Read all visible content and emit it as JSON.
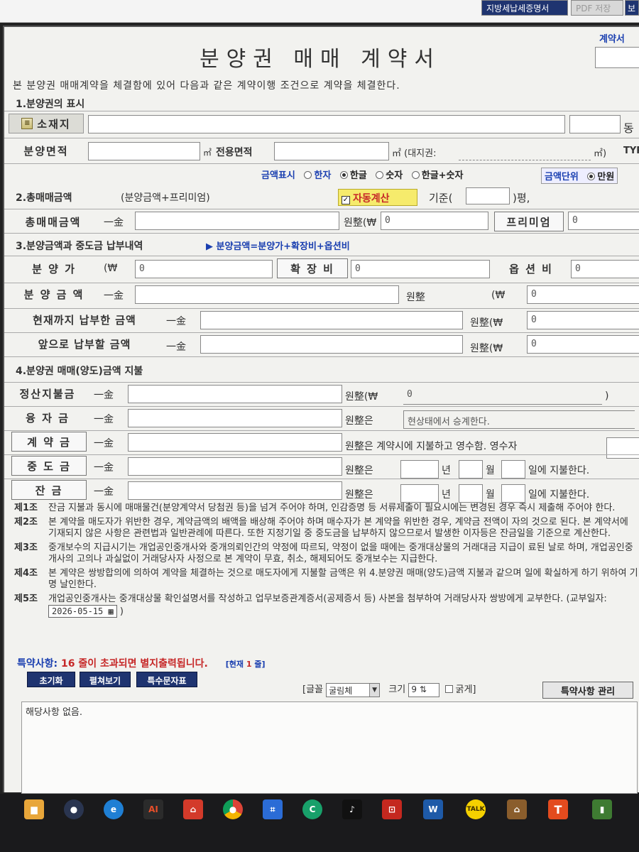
{
  "topbar": {
    "tax_button": "지방세납세증명서",
    "pdf_button": "PDF 저장",
    "right_button": "보"
  },
  "form": {
    "title": "분양권 매매 계약서",
    "contract_label": "계약서",
    "intro": "본 분양권 매매계약을 체결함에 있어 다음과 같은 계약이행 조건으로 계약을 체결한다.",
    "section1": "1.분양권의 표시",
    "location_label": "소재지",
    "dong_label": "동",
    "area_label": "분양면적",
    "area_unit": "㎡",
    "exclusive_label": "전용면적",
    "exclusive_unit": "㎡ (대지권:",
    "land_unit": "㎡)",
    "type_label": "TYP",
    "amount_display_label": "금액표시",
    "amount_display_options": [
      "한자",
      "한글",
      "숫자",
      "한글+숫자"
    ],
    "amount_display_selected": "한글",
    "amount_unit_label": "금액단위",
    "amount_unit_selected": "만원",
    "section2": "2.총매매금액",
    "section2_note": "(분양금액+프리미엄)",
    "auto_calc": "자동계산",
    "basis_prefix": "기준(",
    "basis_suffix": ")평,",
    "total_label": "총매매금액",
    "ilgeum": "一金",
    "won_paren": "원整(₩",
    "premium_label": "프리미엄",
    "premium_value": "0",
    "total_won_value": "0",
    "section3": "3.분양금액과 중도금 납부내역",
    "section3_formula": "▶ 분양금액=분양가+확장비+옵션비",
    "price_label": "분 양 가",
    "price_won_prefix": "(₩",
    "price_value": "0",
    "extension_label": "확 장 비",
    "extension_value": "0",
    "option_label": "옵 션 비",
    "option_value": "0",
    "sale_amount_label": "분 양 금 액",
    "won_text": "원整",
    "won_prefix_paren": "(₩",
    "sale_amount_value": "0",
    "paid_label": "현재까지 납부한 금액",
    "paid_value": "0",
    "due_label": "앞으로 납부할 금액",
    "due_value": "0",
    "section4": "4.분양권 매매(양도)금액 지불",
    "settle_label": "정산지불금",
    "settle_value": "0",
    "close_paren": ")",
    "loan_label": "융 자 금",
    "loan_note": "원整은",
    "loan_text": "현상태에서 승계한다.",
    "deposit_label": "계 약 금",
    "deposit_text": "원整은 계약시에 지불하고 영수함. 영수자",
    "middle_label": "중 도 금",
    "balance_label": "잔   금",
    "won_eun": "원整은",
    "year": "년",
    "month": "월",
    "pay_text": "일에 지불한다.",
    "articles": [
      {
        "num": "제1조",
        "text": "잔금 지불과 동시에 매매물건(분양계약서 당첨권 등)을 넘겨 주어야 하며, 인감증명 등 서류제출이 필요시에는 변경된 경우 즉시 제출해 주어야 한다."
      },
      {
        "num": "제2조",
        "text": "본 계약을 매도자가 위반한 경우, 계약금액의 배액을 배상해 주어야 하며 매수자가 본 계약을 위반한 경우, 계약금 전액이 자의 것으로 된다. 본 계약서에 기재되지 않은 사항은 관련법과 일반관례에 따른다. 또한 지정기일 중 중도금을 납부하지 않으므로서 발생한 이자등은 잔금일을 기준으로 계산한다."
      },
      {
        "num": "제3조",
        "text": "중개보수의 지급시기는 개업공인중개사와 중개의뢰인간의 약정에 따르되, 약정이 없을 때에는 중개대상물의 거래대금 지급이 료된 날로 하며, 개업공인중개사의 고의나 과실없이 거래당사자 사정으로 본 계약이 무효, 취소, 해제되어도 중개보수는 지급한다."
      },
      {
        "num": "제4조",
        "text": "본 계약은 쌍방합의에 의하여 계약을 체결하는 것으로 매도자에게 지불할 금액은 위 4.분양권 매매(양도)금액 지불과 같으며 일에 확실하게 하기 위하여 기명 날인한다."
      },
      {
        "num": "제5조",
        "text": "개업공인중개사는 중개대상물 확인설명서를 작성하고 업무보증관계증서(공제증서 등) 사본을 첨부하여 거래당사자 쌍방에게 교부한다."
      }
    ],
    "delivery_prefix": "(교부일자:",
    "delivery_date": "2026-05-15",
    "delivery_suffix": ")",
    "special_label": "특약사항:",
    "special_warning": "16 줄이 초과되면 별지출력됩니다.",
    "current_prefix": "[현재",
    "current_lines": "1",
    "current_suffix": "줄]",
    "reset_button": "초기화",
    "expand_button": "펼쳐보기",
    "special_char_button": "특수문자표",
    "font_label": "[글꼴",
    "font_value": "굴림체",
    "size_label": "크기",
    "size_value": "9",
    "bold_label": "굵게]",
    "manage_button": "특약사항 관리",
    "notes_text": "해당사항 없음."
  },
  "taskbar": {
    "items": [
      "explorer-icon",
      "browser-icon",
      "edge-icon",
      "ai-icon",
      "home-icon",
      "chrome-icon",
      "crop-icon",
      "green-app-icon",
      "media-icon",
      "red-app-icon",
      "word-icon",
      "kakao-icon",
      "house-icon",
      "t-app-icon",
      "green-app2-icon"
    ],
    "ai_label": "AI",
    "word_label": "W",
    "kakao_label": "TALK",
    "t_label": "T"
  }
}
